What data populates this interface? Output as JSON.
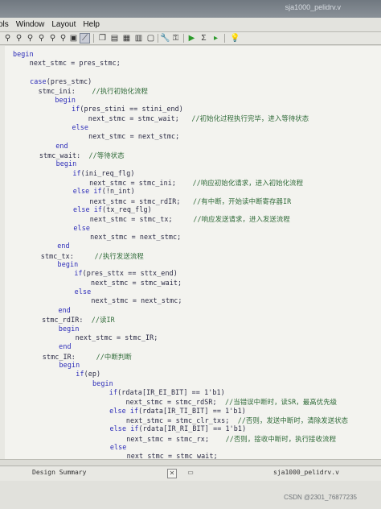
{
  "window": {
    "title": "sja1000_pelidrv.v"
  },
  "menu": [
    "ols",
    "Window",
    "Layout",
    "Help"
  ],
  "toolbar_icons": [
    "wand-icon",
    "wand-icon",
    "wand-icon",
    "wand-icon",
    "wand-icon",
    "zoom-icon",
    "image-icon",
    "copy-icon",
    "window-icon",
    "grid-icon",
    "panel-icon",
    "split-icon",
    "layout-icon",
    "wrench-icon",
    "key-icon",
    "tools-icon",
    "run-icon",
    "sigma-icon",
    "stop-icon",
    "lightbulb-icon"
  ],
  "code_lines": [
    [
      [
        "k",
        "begin"
      ]
    ],
    [
      [
        "t",
        "    next_stmc = pres_stmc;"
      ]
    ],
    [
      [
        "t",
        ""
      ]
    ],
    [
      [
        "t",
        "    "
      ],
      [
        "k",
        "case"
      ],
      [
        "t",
        "(pres_stmc)"
      ]
    ],
    [
      [
        "t",
        "      stmc_ini:    "
      ],
      [
        "c",
        "//执行初始化流程"
      ]
    ],
    [
      [
        "t",
        "          "
      ],
      [
        "k",
        "begin"
      ]
    ],
    [
      [
        "t",
        "              "
      ],
      [
        "k",
        "if"
      ],
      [
        "t",
        "(pres_stini == stini_end)"
      ]
    ],
    [
      [
        "t",
        "                  next_stmc = stmc_wait;   "
      ],
      [
        "c",
        "//初始化过程执行完毕，进入等待状态"
      ]
    ],
    [
      [
        "t",
        "              "
      ],
      [
        "k",
        "else"
      ]
    ],
    [
      [
        "t",
        "                  next_stmc = next_stmc;"
      ]
    ],
    [
      [
        "t",
        "          "
      ],
      [
        "k",
        "end"
      ]
    ],
    [
      [
        "t",
        "      stmc_wait:  "
      ],
      [
        "c",
        "//等待状态"
      ]
    ],
    [
      [
        "t",
        "          "
      ],
      [
        "k",
        "begin"
      ]
    ],
    [
      [
        "t",
        "              "
      ],
      [
        "k",
        "if"
      ],
      [
        "t",
        "(ini_req_flg)"
      ]
    ],
    [
      [
        "t",
        "                  next_stmc = stmc_ini;    "
      ],
      [
        "c",
        "//响应初始化请求，进入初始化流程"
      ]
    ],
    [
      [
        "t",
        "              "
      ],
      [
        "k",
        "else if"
      ],
      [
        "t",
        "(!n_int)"
      ]
    ],
    [
      [
        "t",
        "                  next_stmc = stmc_rdIR;   "
      ],
      [
        "c",
        "//有中断，开始读中断寄存器IR"
      ]
    ],
    [
      [
        "t",
        "              "
      ],
      [
        "k",
        "else if"
      ],
      [
        "t",
        "(tx_req_flg)"
      ]
    ],
    [
      [
        "t",
        "                  next_stmc = stmc_tx;     "
      ],
      [
        "c",
        "//响应发送请求，进入发送流程"
      ]
    ],
    [
      [
        "t",
        "              "
      ],
      [
        "k",
        "else"
      ]
    ],
    [
      [
        "t",
        "                  next_stmc = next_stmc;"
      ]
    ],
    [
      [
        "t",
        "          "
      ],
      [
        "k",
        "end"
      ]
    ],
    [
      [
        "t",
        "      stmc_tx:     "
      ],
      [
        "c",
        "//执行发送流程"
      ]
    ],
    [
      [
        "t",
        "          "
      ],
      [
        "k",
        "begin"
      ]
    ],
    [
      [
        "t",
        "              "
      ],
      [
        "k",
        "if"
      ],
      [
        "t",
        "(pres_sttx == sttx_end)"
      ]
    ],
    [
      [
        "t",
        "                  next_stmc = stmc_wait;"
      ]
    ],
    [
      [
        "t",
        "              "
      ],
      [
        "k",
        "else"
      ]
    ],
    [
      [
        "t",
        "                  next_stmc = next_stmc;"
      ]
    ],
    [
      [
        "t",
        "          "
      ],
      [
        "k",
        "end"
      ]
    ],
    [
      [
        "t",
        "      stmc_rdIR:  "
      ],
      [
        "c",
        "//读IR"
      ]
    ],
    [
      [
        "t",
        "          "
      ],
      [
        "k",
        "begin"
      ]
    ],
    [
      [
        "t",
        "              next_stmc = stmc_IR;"
      ]
    ],
    [
      [
        "t",
        "          "
      ],
      [
        "k",
        "end"
      ]
    ],
    [
      [
        "t",
        "      stmc_IR:     "
      ],
      [
        "c",
        "//中断判断"
      ]
    ],
    [
      [
        "t",
        "          "
      ],
      [
        "k",
        "begin"
      ]
    ],
    [
      [
        "t",
        "              "
      ],
      [
        "k",
        "if"
      ],
      [
        "t",
        "(ep)"
      ]
    ],
    [
      [
        "t",
        "                  "
      ],
      [
        "k",
        "begin"
      ]
    ],
    [
      [
        "t",
        "                      "
      ],
      [
        "k",
        "if"
      ],
      [
        "t",
        "(rdata[IR_EI_BIT] == 1'b1)"
      ]
    ],
    [
      [
        "t",
        "                          next_stmc = stmc_rdSR;  "
      ],
      [
        "c",
        "//当错误中断时，读SR，最高优先级"
      ]
    ],
    [
      [
        "t",
        "                      "
      ],
      [
        "k",
        "else if"
      ],
      [
        "t",
        "(rdata[IR_TI_BIT] == 1'b1)"
      ]
    ],
    [
      [
        "t",
        "                          next_stmc = stmc_clr_txs;  "
      ],
      [
        "c",
        "//否则，发送中断时，清除发送状态"
      ]
    ],
    [
      [
        "t",
        "                      "
      ],
      [
        "k",
        "else if"
      ],
      [
        "t",
        "(rdata[IR_RI_BIT] == 1'b1)"
      ]
    ],
    [
      [
        "t",
        "                          next_stmc = stmc_rx;    "
      ],
      [
        "c",
        "//否则，接收中断时，执行接收流程"
      ]
    ],
    [
      [
        "t",
        "                      "
      ],
      [
        "k",
        "else"
      ]
    ],
    [
      [
        "t",
        "                          next_stmc = stmc_wait;"
      ]
    ]
  ],
  "tabs": {
    "left": "Design Summary",
    "right": "sja1000_pelidrv.v",
    "close_glyph": "✕"
  },
  "watermark": "CSDN @2301_76877235"
}
